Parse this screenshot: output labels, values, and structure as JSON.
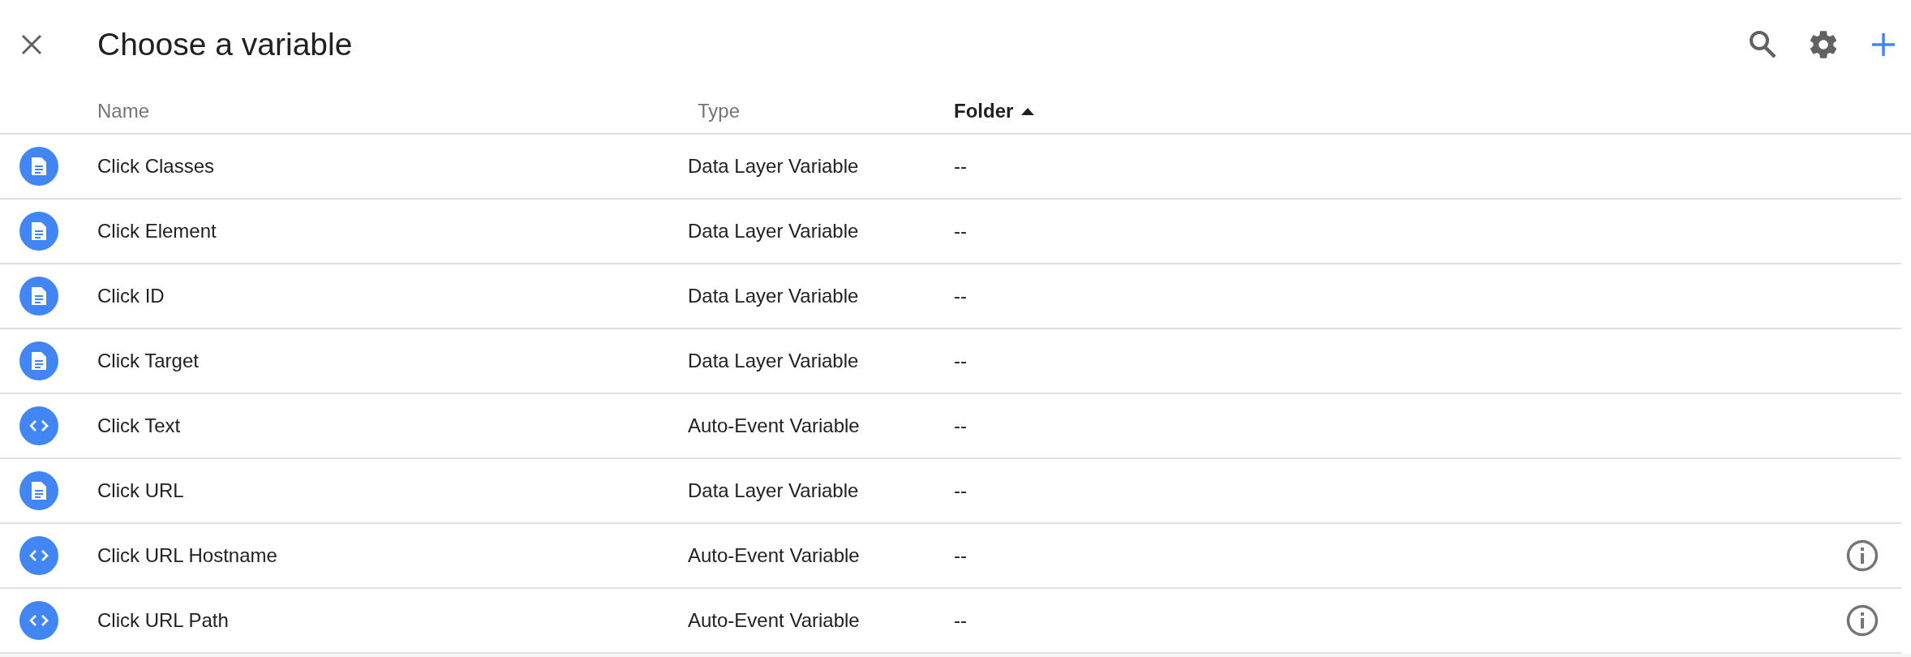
{
  "header": {
    "title": "Choose a variable"
  },
  "table": {
    "columns": [
      {
        "label": "Name",
        "sorted": false
      },
      {
        "label": "Type",
        "sorted": false
      },
      {
        "label": "Folder",
        "sorted": true
      }
    ],
    "rows": [
      {
        "kind": "document",
        "name": "Click Classes",
        "type": "Data Layer Variable",
        "folder": "--",
        "info": false
      },
      {
        "kind": "document",
        "name": "Click Element",
        "type": "Data Layer Variable",
        "folder": "--",
        "info": false
      },
      {
        "kind": "document",
        "name": "Click ID",
        "type": "Data Layer Variable",
        "folder": "--",
        "info": false
      },
      {
        "kind": "document",
        "name": "Click Target",
        "type": "Data Layer Variable",
        "folder": "--",
        "info": false
      },
      {
        "kind": "code",
        "name": "Click Text",
        "type": "Auto-Event Variable",
        "folder": "--",
        "info": false
      },
      {
        "kind": "document",
        "name": "Click URL",
        "type": "Data Layer Variable",
        "folder": "--",
        "info": false
      },
      {
        "kind": "code",
        "name": "Click URL Hostname",
        "type": "Auto-Event Variable",
        "folder": "--",
        "info": true
      },
      {
        "kind": "code",
        "name": "Click URL Path",
        "type": "Auto-Event Variable",
        "folder": "--",
        "info": true
      }
    ]
  }
}
